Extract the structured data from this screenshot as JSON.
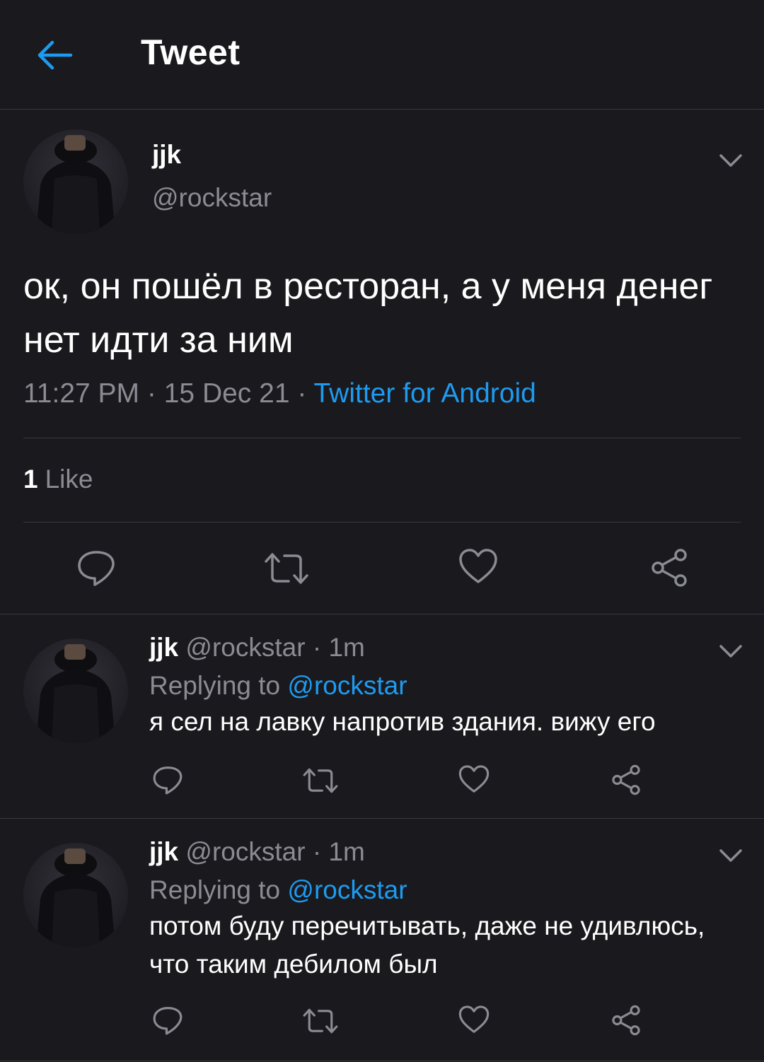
{
  "header": {
    "title": "Tweet"
  },
  "main_tweet": {
    "name": "jjk",
    "handle": "@rockstar",
    "text": "ок, он пошёл в ресторан, а у меня денег нет идти за ним",
    "time": "11:27 PM",
    "separator": "·",
    "date": "15 Dec 21",
    "source": "Twitter for Android",
    "likes_count": "1",
    "likes_label": "Like"
  },
  "replies": [
    {
      "name": "jjk",
      "handle": "@rockstar",
      "separator": "·",
      "time": "1m",
      "replying_prefix": "Replying to",
      "replying_to": "@rockstar",
      "text": "я сел на лавку напротив здания. вижу его"
    },
    {
      "name": "jjk",
      "handle": "@rockstar",
      "separator": "·",
      "time": "1m",
      "replying_prefix": "Replying to",
      "replying_to": "@rockstar",
      "text": "потом буду перечитывать, даже не удивлюсь, что таким дебилом был"
    }
  ],
  "icons": [
    "back-arrow-icon",
    "chevron-down-icon",
    "reply-icon",
    "retweet-icon",
    "like-icon",
    "share-icon"
  ],
  "colors": {
    "background": "#1a191d",
    "accent": "#1d9bf0",
    "secondary_text": "#8b8b93",
    "divider": "#3a3940"
  }
}
